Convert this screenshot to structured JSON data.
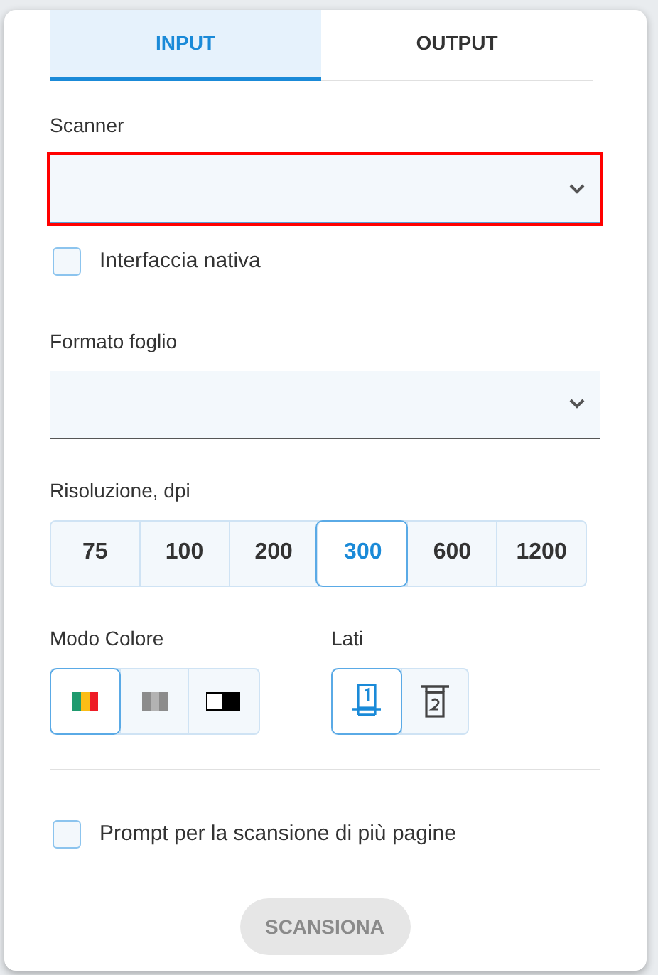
{
  "tabs": [
    {
      "label": "INPUT",
      "selected": true
    },
    {
      "label": "OUTPUT",
      "selected": false
    }
  ],
  "scanner": {
    "label": "Scanner",
    "error": true
  },
  "native_interface": {
    "label": "Interfaccia nativa",
    "checked": false
  },
  "paper_format": {
    "label": "Formato foglio",
    "error": false
  },
  "resolution": {
    "label": "Risoluzione, dpi",
    "options": [
      {
        "label": "75",
        "selected": false
      },
      {
        "label": "100",
        "selected": false
      },
      {
        "label": "200",
        "selected": false
      },
      {
        "label": "300",
        "selected": true
      },
      {
        "label": "600",
        "selected": false
      },
      {
        "label": "1200",
        "selected": false
      }
    ]
  },
  "color_mode": {
    "label": "Modo Colore",
    "options": [
      {
        "kind": "color",
        "selected": true
      },
      {
        "kind": "gray",
        "selected": false
      },
      {
        "kind": "bw",
        "selected": false
      }
    ]
  },
  "sides": {
    "label": "Lati",
    "options": [
      {
        "kind": "single",
        "selected": true
      },
      {
        "kind": "double",
        "selected": false
      }
    ]
  },
  "multi_page_prompt": {
    "label": "Prompt per la scansione di più pagine",
    "checked": false
  },
  "scan_button": {
    "label": "SCANSIONA",
    "disabled": true
  }
}
